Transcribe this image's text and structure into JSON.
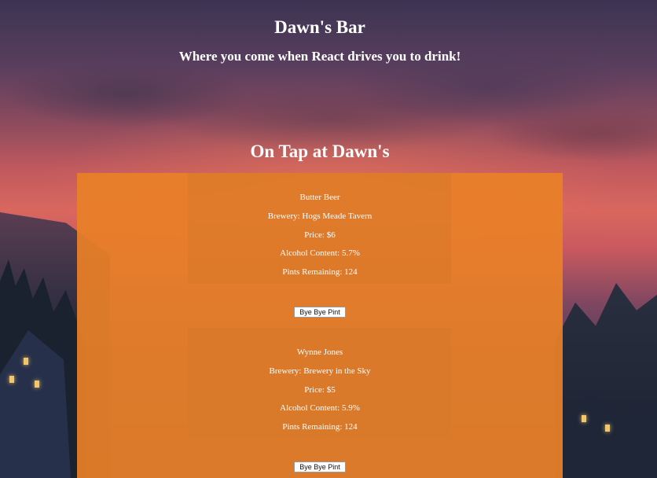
{
  "site": {
    "title": "Dawn's Bar",
    "tagline": "Where you come when React drives you to drink!"
  },
  "tap_list": {
    "heading": "On Tap at Dawn's",
    "kegs": [
      {
        "name": "Butter Beer",
        "brewery": "Brewery: Hogs Meade Tavern",
        "price": "Price: $6",
        "alcohol": "Alcohol Content: 5.7%",
        "pints": "Pints Remaining: 124",
        "button_label": "Bye Bye Pint"
      },
      {
        "name": "Wynne Jones",
        "brewery": "Brewery: Brewery in the Sky",
        "price": "Price: $5",
        "alcohol": "Alcohol Content: 5.9%",
        "pints": "Pints Remaining: 124",
        "button_label": "Bye Bye Pint"
      }
    ]
  },
  "colors": {
    "panel": "#e88028",
    "text": "#ffffff",
    "sky_top": "#3b3452",
    "sky_glow": "#d9675f"
  }
}
